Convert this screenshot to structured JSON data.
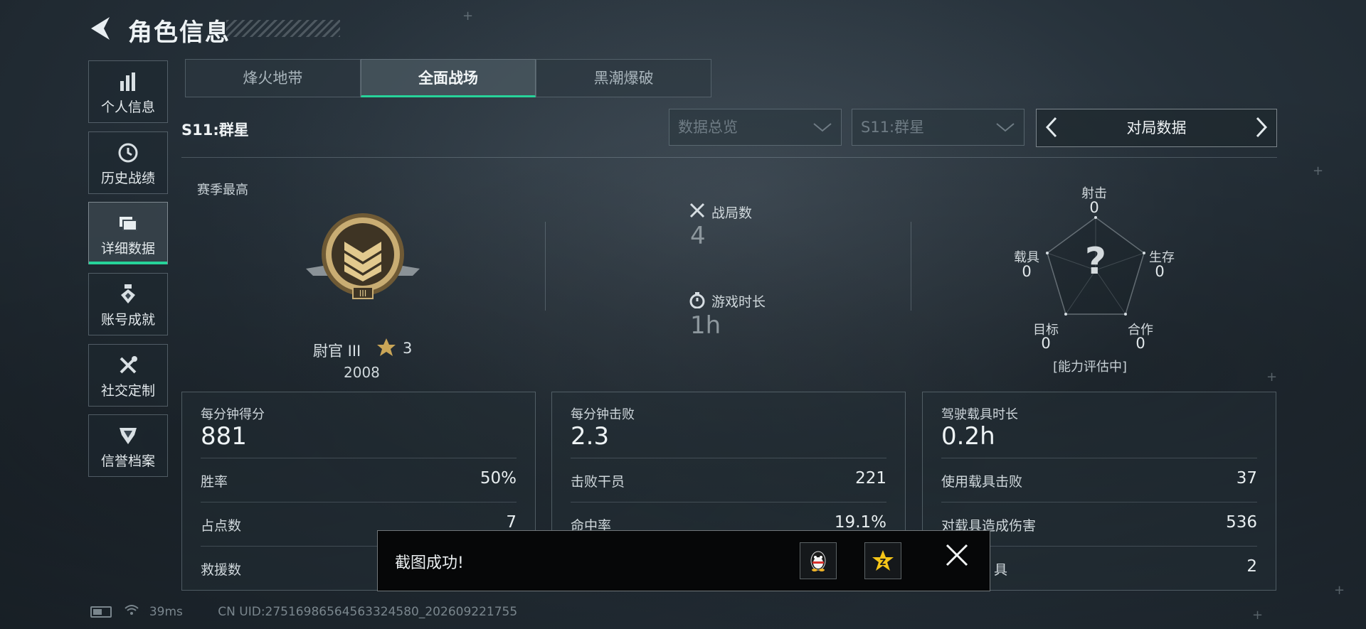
{
  "header": {
    "title": "角色信息"
  },
  "sidebar": {
    "items": [
      {
        "label": "个人信息",
        "icon": "bar-chart-icon"
      },
      {
        "label": "历史战绩",
        "icon": "history-clock-icon"
      },
      {
        "label": "详细数据",
        "icon": "folder-icon",
        "active": true
      },
      {
        "label": "账号成就",
        "icon": "medal-icon"
      },
      {
        "label": "社交定制",
        "icon": "tools-icon"
      },
      {
        "label": "信誉档案",
        "icon": "shield-emblem-icon"
      }
    ]
  },
  "tabs": [
    {
      "label": "烽火地带"
    },
    {
      "label": "全面战场",
      "active": true
    },
    {
      "label": "黑潮爆破"
    }
  ],
  "filters": {
    "season_title": "S11:群星",
    "dropdown1": "数据总览",
    "dropdown2": "S11:群星",
    "switcher": "对局数据"
  },
  "season_best": {
    "label": "赛季最高",
    "rank_name": "尉官 III",
    "stars": "3",
    "score": "2008"
  },
  "middle_stats": {
    "matches_label": "战局数",
    "matches_value": "4",
    "playtime_label": "游戏时长",
    "playtime_value": "1h"
  },
  "radar": {
    "shooting_label": "射击",
    "shooting_value": "0",
    "survival_label": "生存",
    "survival_value": "0",
    "teamwork_label": "合作",
    "teamwork_value": "0",
    "objective_label": "目标",
    "objective_value": "0",
    "vehicle_label": "载具",
    "vehicle_value": "0",
    "center_mark": "?",
    "note": "[能力评估中]"
  },
  "cards": [
    {
      "label": "每分钟得分",
      "value": "881",
      "rows": [
        {
          "label": "胜率",
          "value": "50%"
        },
        {
          "label": "占点数",
          "value": "7"
        },
        {
          "label": "救援数",
          "value": ""
        }
      ]
    },
    {
      "label": "每分钟击败",
      "value": "2.3",
      "rows": [
        {
          "label": "击败干员",
          "value": "221"
        },
        {
          "label": "命中率",
          "value": "19.1%"
        },
        {
          "label": "",
          "value": ""
        }
      ]
    },
    {
      "label": "驾驶载具时长",
      "value": "0.2h",
      "rows": [
        {
          "label": "使用载具击败",
          "value": "37"
        },
        {
          "label": "对载具造成伤害",
          "value": "536"
        },
        {
          "label": "具",
          "value": "2"
        }
      ]
    }
  ],
  "toast": {
    "text": "截图成功!"
  },
  "footer": {
    "ping": "39ms",
    "uid": "CN UID:2751698656456332458​0_202609221755"
  },
  "colors": {
    "accent": "#27d39a"
  }
}
